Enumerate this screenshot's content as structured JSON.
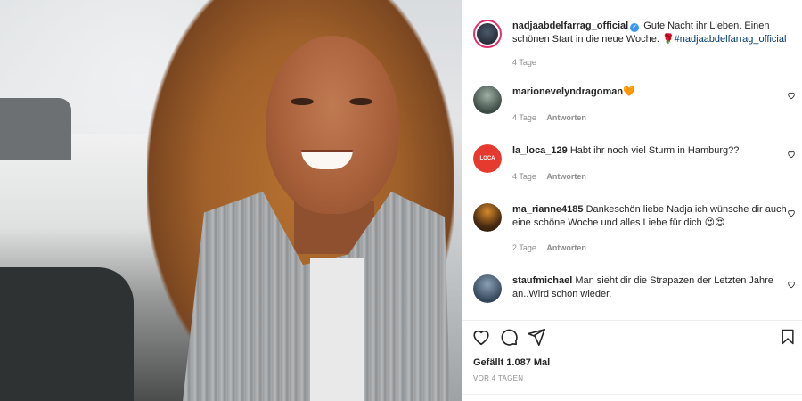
{
  "post": {
    "caption": {
      "username": "nadjaabdelfarrag_official",
      "text": "Gute Nacht ihr Lieben. Einen schönen Start in die neue Woche. 🌹",
      "hashtag": "#nadjaabdelfarrag_official",
      "time": "4 Tage"
    },
    "comments": [
      {
        "username": "marionevelyndragoman",
        "text": "🧡",
        "time": "4 Tage",
        "reply": "Antworten"
      },
      {
        "username": "la_loca_129",
        "text": "Habt ihr noch viel Sturm in Hamburg??",
        "time": "4 Tage",
        "reply": "Antworten"
      },
      {
        "username": "ma_rianne4185",
        "text": "Dankeschön liebe Nadja ich wünsche dir auch eine schöne Woche und alles Liebe für dich 😍😍",
        "time": "2 Tage",
        "reply": "Antworten"
      },
      {
        "username": "staufmichael",
        "text": "Man sieht dir die Strapazen der Letzten Jahre an..Wird schon wieder.",
        "time": "",
        "reply": ""
      }
    ],
    "likes": "Gefällt 1.087 Mal",
    "timestamp": "VOR 4 TAGEN"
  },
  "icons": {
    "like": "heart-icon",
    "comment": "comment-icon",
    "share": "send-icon",
    "save": "bookmark-icon",
    "verified": "verified-badge-icon"
  },
  "colors": {
    "hashtag": "#00376b",
    "verified": "#3897f0",
    "muted": "#8e8e8e"
  }
}
